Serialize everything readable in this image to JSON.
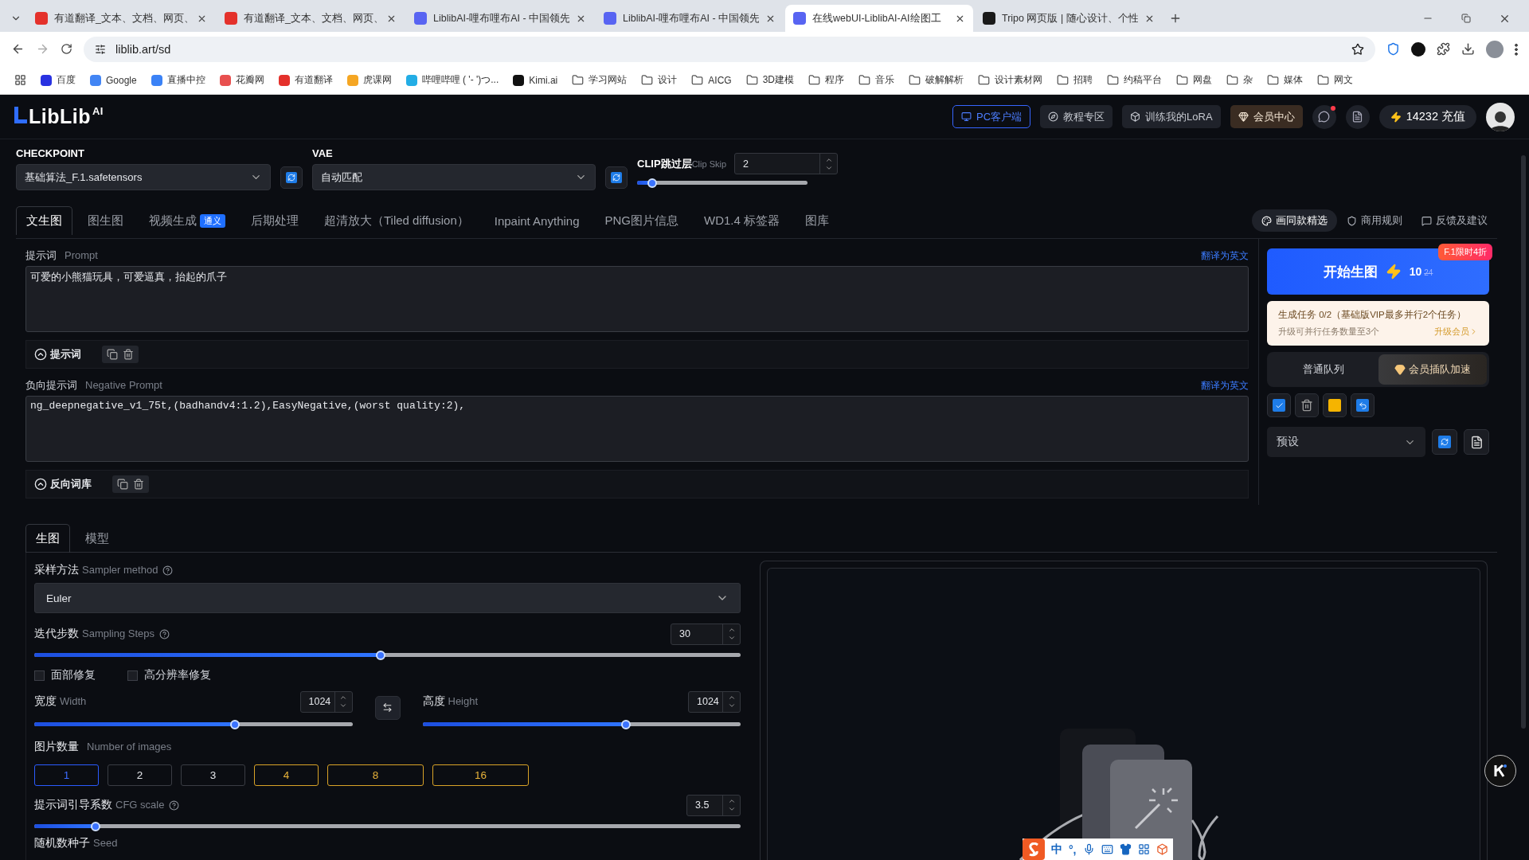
{
  "browser": {
    "tabs": [
      {
        "title": "有道翻译_文本、文档、网页、",
        "kind": "youdao",
        "selected": false
      },
      {
        "title": "有道翻译_文本、文档、网页、",
        "kind": "youdao",
        "selected": false
      },
      {
        "title": "LiblibAI-哩布哩布AI - 中国领先",
        "kind": "liblib",
        "selected": false
      },
      {
        "title": "LiblibAI-哩布哩布AI - 中国领先",
        "kind": "liblib",
        "selected": false
      },
      {
        "title": "在线webUI-LiblibAI-AI绘图工",
        "kind": "liblib",
        "selected": true
      },
      {
        "title": "Tripo 网页版 | 随心设计、个性",
        "kind": "tripo",
        "selected": false
      }
    ],
    "address": "liblib.art/sd",
    "bookmarks": [
      {
        "label": "百度",
        "kind": "site",
        "color": "#2932e1"
      },
      {
        "label": "Google",
        "kind": "site",
        "color": "#4285f4"
      },
      {
        "label": "直播中控",
        "kind": "site",
        "color": "#3b82f6"
      },
      {
        "label": "花瓣网",
        "kind": "site",
        "color": "#e8504f"
      },
      {
        "label": "有道翻译",
        "kind": "site",
        "color": "#e4312b"
      },
      {
        "label": "虎课网",
        "kind": "site",
        "color": "#f5a623"
      },
      {
        "label": "哔哩哔哩 ( '- ')つ...",
        "kind": "site",
        "color": "#23ade5"
      },
      {
        "label": "Kimi.ai",
        "kind": "site",
        "color": "#111111"
      },
      {
        "label": "学习网站",
        "kind": "folder"
      },
      {
        "label": "设计",
        "kind": "folder"
      },
      {
        "label": "AICG",
        "kind": "folder"
      },
      {
        "label": "3D建模",
        "kind": "folder"
      },
      {
        "label": "程序",
        "kind": "folder"
      },
      {
        "label": "音乐",
        "kind": "folder"
      },
      {
        "label": "破解解析",
        "kind": "folder"
      },
      {
        "label": "设计素材网",
        "kind": "folder"
      },
      {
        "label": "招聘",
        "kind": "folder"
      },
      {
        "label": "约稿平台",
        "kind": "folder"
      },
      {
        "label": "网盘",
        "kind": "folder"
      },
      {
        "label": "杂",
        "kind": "folder"
      },
      {
        "label": "媒体",
        "kind": "folder"
      },
      {
        "label": "网文",
        "kind": "folder"
      }
    ]
  },
  "header": {
    "logo": "LibLib",
    "logo_sup": "AI",
    "buttons": [
      {
        "label": "PC客户端",
        "kind": "client"
      },
      {
        "label": "教程专区",
        "kind": "course"
      },
      {
        "label": "训练我的LoRA",
        "kind": "train"
      },
      {
        "label": "会员中心",
        "kind": "member"
      }
    ],
    "notification": true,
    "credits": "14232",
    "recharge": "充值"
  },
  "model_bar": {
    "checkpoint": {
      "label": "CHECKPOINT",
      "value": "基础算法_F.1.safetensors"
    },
    "vae": {
      "label": "VAE",
      "value": "自动匹配"
    },
    "clip": {
      "label": "CLIP跳过层",
      "sublabel": "Clip Skip",
      "value": "2",
      "level": 0.09
    }
  },
  "main_tabs": [
    {
      "label": "文生图",
      "selected": true
    },
    {
      "label": "图生图",
      "selected": false
    },
    {
      "label": "视频生成",
      "badge": "通义",
      "selected": false
    },
    {
      "label": "后期处理",
      "selected": false
    },
    {
      "label": "超清放大（Tiled diffusion）",
      "selected": false
    },
    {
      "label": "Inpaint Anything",
      "selected": false
    },
    {
      "label": "PNG图片信息",
      "selected": false
    },
    {
      "label": "WD1.4 标签器",
      "selected": false
    },
    {
      "label": "图库",
      "selected": false
    }
  ],
  "top_links": [
    {
      "label": "画同款精选",
      "kind": "pill"
    },
    {
      "label": "商用规则",
      "kind": "plain"
    },
    {
      "label": "反馈及建议",
      "kind": "plain"
    }
  ],
  "prompt": {
    "label": "提示词",
    "sublabel": "Prompt",
    "translate": "翻译为英文",
    "value": "可爱的小熊猫玩具，可爱逼真，抬起的爪子",
    "toolbar": "提示词"
  },
  "negative_prompt": {
    "label": "负向提示词",
    "sublabel": "Negative Prompt",
    "translate": "翻译为英文",
    "value": "ng_deepnegative_v1_75t,(badhandv4:1.2),EasyNegative,(worst quality:2),",
    "toolbar": "反向词库"
  },
  "generate": {
    "label": "开始生图",
    "cost": "10",
    "old_cost": "24",
    "badge": "F.1限时4折"
  },
  "task": {
    "line": "生成任务 0/2（基础版VIP最多并行2个任务）",
    "hint": "升级可并行任务数量至3个",
    "link": "升级会员"
  },
  "queues": [
    {
      "label": "普通队列",
      "vip": false,
      "selected": false
    },
    {
      "label": "会员插队加速",
      "vip": true,
      "selected": true
    }
  ],
  "preset": {
    "placeholder": "预设"
  },
  "sub_tabs": [
    {
      "label": "生图",
      "selected": true
    },
    {
      "label": "模型",
      "selected": false
    }
  ],
  "params": {
    "sampler": {
      "label": "采样方法",
      "sublabel": "Sampler method",
      "value": "Euler"
    },
    "steps": {
      "label": "迭代步数",
      "sublabel": "Sampling Steps",
      "value": "30",
      "level": 0.49
    },
    "checkboxes": [
      {
        "label": "面部修复",
        "checked": false
      },
      {
        "label": "高分辨率修复",
        "checked": false
      }
    ],
    "width": {
      "label": "宽度",
      "sublabel": "Width",
      "value": "1024",
      "level": 0.63
    },
    "height": {
      "label": "高度",
      "sublabel": "Height",
      "value": "1024",
      "level": 0.64
    },
    "images": {
      "label": "图片数量",
      "sublabel": "Number of images",
      "options": [
        {
          "label": "1",
          "kind": "free",
          "selected": true
        },
        {
          "label": "2",
          "kind": "free",
          "selected": false
        },
        {
          "label": "3",
          "kind": "free",
          "selected": false
        },
        {
          "label": "4",
          "kind": "vip",
          "selected": false
        },
        {
          "label": "8",
          "kind": "vip",
          "selected": false
        },
        {
          "label": "16",
          "kind": "vip",
          "selected": false
        }
      ]
    },
    "cfg": {
      "label": "提示词引导系数",
      "sublabel": "CFG scale",
      "value": "3.5",
      "level": 0.087
    },
    "seed": {
      "label": "随机数种子",
      "sublabel": "Seed"
    }
  },
  "ime": {
    "mode": "中",
    "punct": "°,"
  }
}
